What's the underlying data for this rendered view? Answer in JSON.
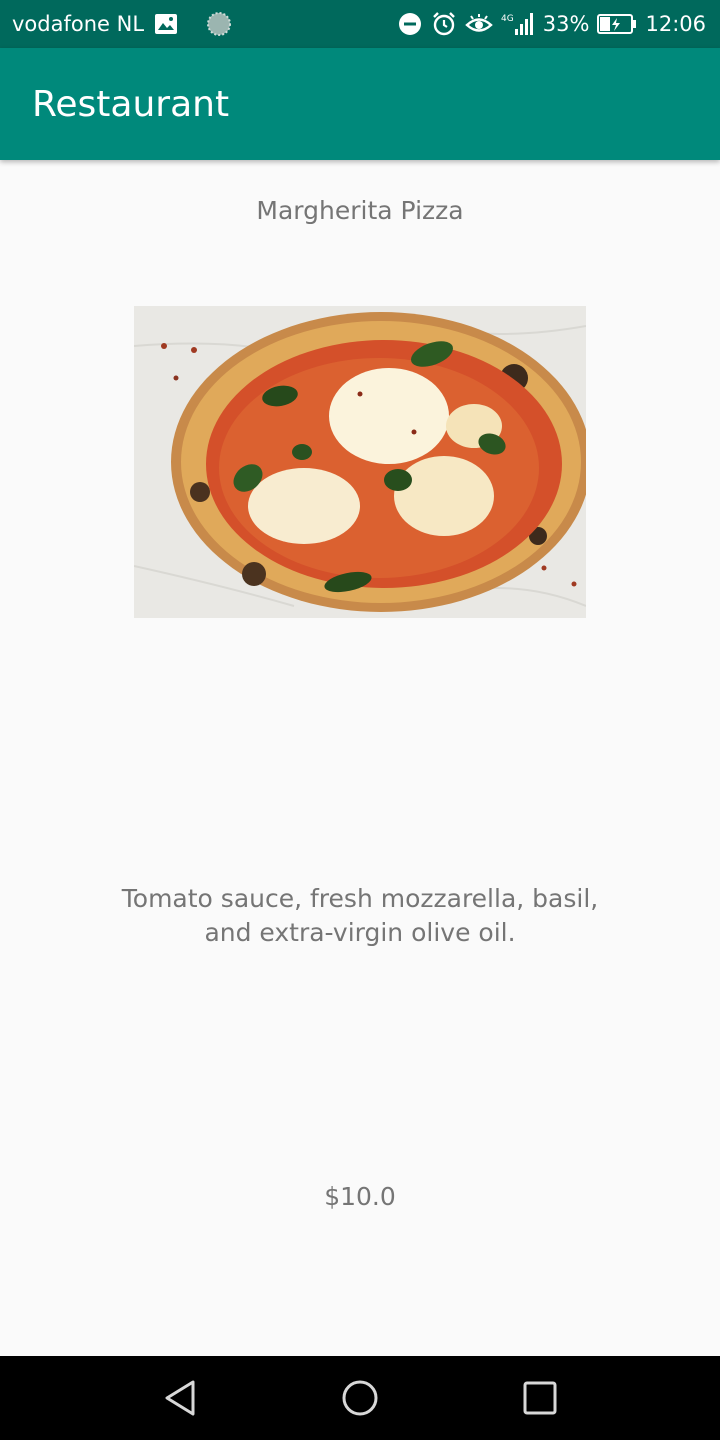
{
  "status_bar": {
    "carrier": "vodafone NL",
    "network": "4G",
    "battery": "33%",
    "time": "12:06",
    "icons": [
      "image-notification-icon",
      "sync-notification-icon",
      "do-not-disturb-icon",
      "alarm-icon",
      "eye-comfort-icon",
      "signal-icon",
      "battery-charging-icon"
    ]
  },
  "app_bar": {
    "title": "Restaurant",
    "color": "#00897b"
  },
  "item": {
    "name": "Margherita Pizza",
    "image_alt": "Margherita Pizza",
    "description": "Tomato sauce, fresh mozzarella, basil, and extra-virgin olive oil.",
    "price": "$10.0"
  },
  "nav_bar": {
    "icons": [
      "back-icon",
      "home-icon",
      "recents-icon"
    ]
  },
  "colors": {
    "status_bar": "#00695c",
    "app_bar": "#00897b",
    "background": "#fafafa",
    "text": "#757575"
  }
}
